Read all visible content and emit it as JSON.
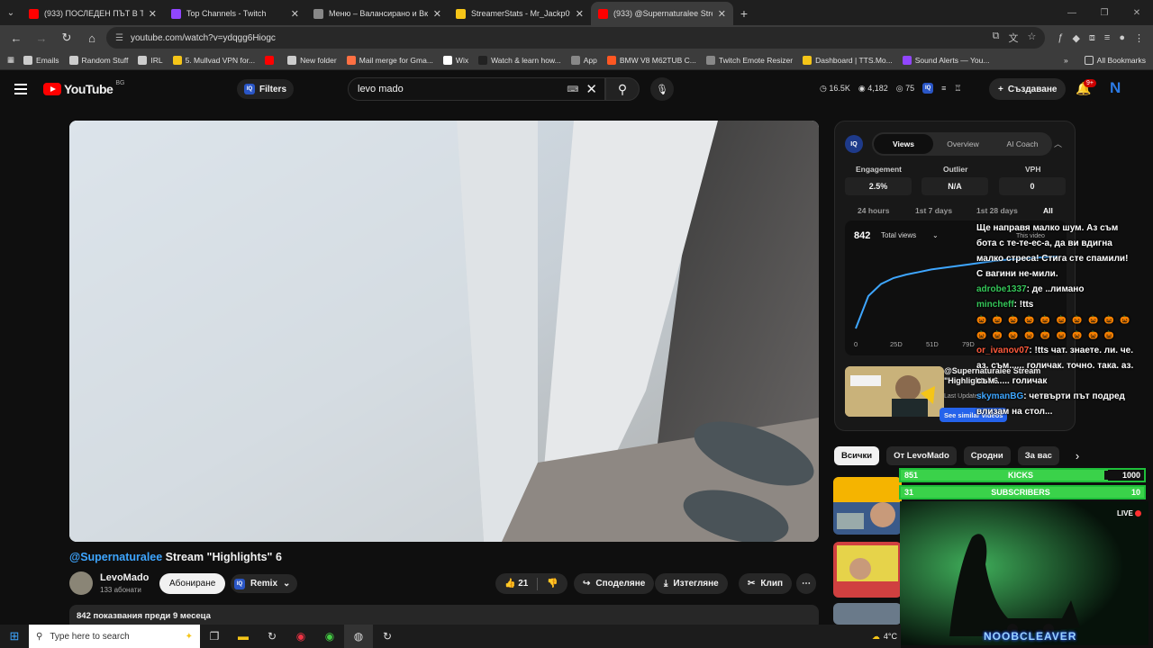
{
  "browser": {
    "tabs": [
      {
        "label": "(933) ПОСЛЕДЕН ПЪТ В ТЪРСЕ...",
        "favicon_color": "#ff0000",
        "active": false
      },
      {
        "label": "Top Channels - Twitch",
        "favicon_color": "#9146ff",
        "active": false
      },
      {
        "label": "Меню – Валансирано и Вкусно...",
        "favicon_color": "#888888",
        "active": false
      },
      {
        "label": "StreamerStats - Mr_Jackp0t Pro...",
        "favicon_color": "#f5c518",
        "active": false
      },
      {
        "label": "(933) @Supernaturalee Stre...",
        "favicon_color": "#ff0000",
        "active": true
      }
    ],
    "url": "youtube.com/watch?v=ydqgg6Hiogc",
    "bookmarks": [
      {
        "label": "Emails",
        "icon_color": "#cccccc"
      },
      {
        "label": "Random Stuff",
        "icon_color": "#cccccc"
      },
      {
        "label": "IRL",
        "icon_color": "#cccccc"
      },
      {
        "label": "5. Mullvad VPN for...",
        "icon_color": "#f5c518"
      },
      {
        "label": "",
        "icon_color": "#ff0000"
      },
      {
        "label": "New folder",
        "icon_color": "#cccccc"
      },
      {
        "label": "Mail merge for Gma...",
        "icon_color": "#ff7043"
      },
      {
        "label": "Wix",
        "icon_color": "#ffffff"
      },
      {
        "label": "Watch & learn how...",
        "icon_color": "#222222"
      },
      {
        "label": "App",
        "icon_color": "#888888"
      },
      {
        "label": "BMW V8 M62TUB C...",
        "icon_color": "#ff5722"
      },
      {
        "label": "Twitch Emote Resizer",
        "icon_color": "#888888"
      },
      {
        "label": "Dashboard | TTS.Mo...",
        "icon_color": "#f5c518"
      },
      {
        "label": "Sound Alerts — You...",
        "icon_color": "#9146ff"
      }
    ],
    "all_bookmarks": "All Bookmarks"
  },
  "youtube": {
    "logo_word": "YouTube",
    "region": "BG",
    "filters_label": "Filters",
    "search_query": "levo mado",
    "stats": {
      "views": "16.5K",
      "watching": "4,182",
      "viewers": "75"
    },
    "create_label": "Създаване",
    "notifications_badge": "9+",
    "video": {
      "title_mention": "@Supernaturalee",
      "title_rest": " Stream \"Highlights\" 6",
      "channel_name": "LevoMado",
      "channel_subs": "133 абонати",
      "subscribe_label": "Абониране",
      "remix_label": "Remix",
      "likes": "21",
      "share_label": "Споделяне",
      "download_label": "Изтегляне",
      "clip_label": "Клип",
      "description": "842 показвания  преди 9 месеца"
    },
    "chips": [
      "Всички",
      "От LevoMado",
      "Сродни",
      "За вас"
    ]
  },
  "analytics": {
    "tabs": [
      "Views",
      "Overview",
      "AI Coach"
    ],
    "metrics": [
      {
        "label": "Engagement",
        "value": "2.5%"
      },
      {
        "label": "Outlier",
        "value": "N/A"
      },
      {
        "label": "VPH",
        "value": "0"
      }
    ],
    "ranges": [
      "24 hours",
      "1st 7 days",
      "1st 28 days",
      "All"
    ],
    "total": "842",
    "total_label": "Total views",
    "this_video": "This video",
    "recommend_title": "@Supernaturalee Stream \"Highlights\" 6",
    "recommend_sub": "Last Updated",
    "recommend_btn": "See similar videos"
  },
  "chart_data": {
    "type": "line",
    "title": "",
    "xlabel": "",
    "ylabel": "",
    "x_ticks": [
      "0",
      "25D",
      "51D",
      "79D"
    ],
    "series": [
      {
        "values": [
          0,
          380,
          520,
          590,
          630,
          660,
          690,
          710,
          730,
          750,
          770,
          790,
          805,
          815,
          825,
          835,
          842
        ]
      }
    ]
  },
  "stream_overlay": {
    "chat": [
      {
        "user": "",
        "text": "Ще направя малко шум. Аз съм бота с те-те-ес-а, да ви вдигна малко стреса! Стига сте спамили! С вагини не-мили."
      },
      {
        "user": "adrobe1337",
        "text": ": де ..лимано"
      },
      {
        "user": "mincheff",
        "text": ": !tts"
      },
      {
        "user": "",
        "text": "🎃 🎃 🎃 🎃 🎃 🎃 🎃 🎃 🎃 🎃 🎃 🎃 🎃 🎃 🎃 🎃 🎃 🎃 🎃"
      },
      {
        "user": "or_ivanov07",
        "text": ": !tts чат. знаете. ли. че. аз. съм...... голичак. точно. така. аз. съм...... голичак"
      },
      {
        "user": "skymanBG",
        "text": ": четвърти път подред влизам на стол..."
      }
    ],
    "goals": [
      {
        "current": "851",
        "name": "KICKS",
        "target": "1000",
        "progress": 0.851
      },
      {
        "current": "31",
        "name": "SUBSCRIBERS",
        "target": "10",
        "progress": 1.0
      }
    ],
    "live_label": "LIVE",
    "streamer_name": "NOOBCLEAVER"
  },
  "taskbar": {
    "search_placeholder": "Type here to search",
    "weather": "4°C"
  }
}
